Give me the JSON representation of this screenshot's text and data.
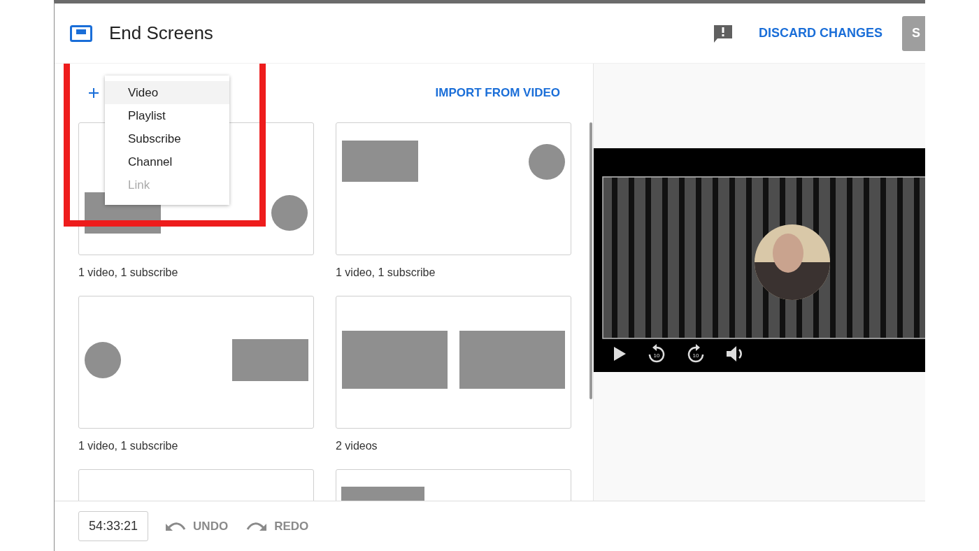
{
  "dialog": {
    "title": "End Screens",
    "discard": "DISCARD CHANGES",
    "save": "S"
  },
  "add_menu": {
    "items": [
      {
        "label": "Video",
        "selected": true,
        "disabled": false
      },
      {
        "label": "Playlist",
        "selected": false,
        "disabled": false
      },
      {
        "label": "Subscribe",
        "selected": false,
        "disabled": false
      },
      {
        "label": "Channel",
        "selected": false,
        "disabled": false
      },
      {
        "label": "Link",
        "selected": false,
        "disabled": true
      }
    ]
  },
  "import": "IMPORT FROM VIDEO",
  "templates": [
    {
      "kind": "video-bottom-subscribe-right",
      "caption": "1 video, 1 subscribe"
    },
    {
      "kind": "video-top-subscribe-right",
      "caption": "1 video, 1 subscribe"
    },
    {
      "kind": "subscribe-left-video-right",
      "caption": "1 video, 1 subscribe"
    },
    {
      "kind": "two-videos",
      "caption": "2 videos"
    },
    {
      "kind": "empty"
    },
    {
      "kind": "video-top-left"
    }
  ],
  "player": {
    "controls": [
      {
        "kind": "play"
      },
      {
        "kind": "rewind",
        "label": "10"
      },
      {
        "kind": "forward",
        "label": "10"
      },
      {
        "kind": "volume"
      }
    ]
  },
  "footer": {
    "time": "54:33:21",
    "undo": "UNDO",
    "redo": "REDO"
  }
}
